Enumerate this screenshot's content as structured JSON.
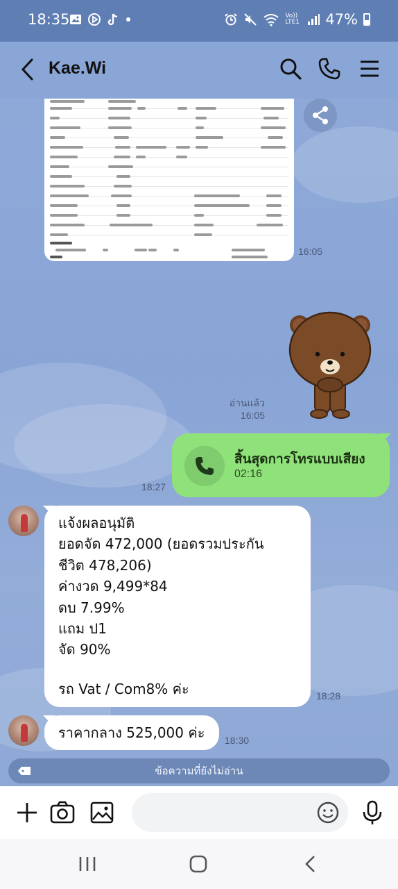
{
  "status_bar": {
    "time": "18:35",
    "battery": "47%",
    "network": "Vo)) LTE1"
  },
  "header": {
    "title": "Kae.Wi"
  },
  "messages": {
    "image_time": "16:05",
    "sticker_read": "อ่านแล้ว",
    "sticker_time": "16:05",
    "call": {
      "title": "สิ้นสุดการโทรแบบเสียง",
      "duration": "02:16",
      "time": "18:27"
    },
    "approval": {
      "lines": [
        "แจ้งผลอนุมัติ",
        "ยอดจัด 472,000 (ยอดรวมประกัน",
        "ชีวิต 478,206)",
        "ค่างวด 9,499*84",
        "ดบ 7.99%",
        "แถม ป1",
        "จัด 90%",
        "",
        "รถ Vat / Com8% ค่ะ"
      ],
      "time": "18:28"
    },
    "price": {
      "text": "ราคากลาง 525,000 ค่ะ",
      "time": "18:30"
    }
  },
  "unread_banner": "ข้อความที่ยังไม่อ่าน",
  "colors": {
    "chat_bg": "#8aa6d6",
    "status_bar_bg": "#5f7fb4",
    "call_bubble": "#8fe27a",
    "incoming_bubble": "#ffffff",
    "unread_banner": "#6d88b7"
  }
}
